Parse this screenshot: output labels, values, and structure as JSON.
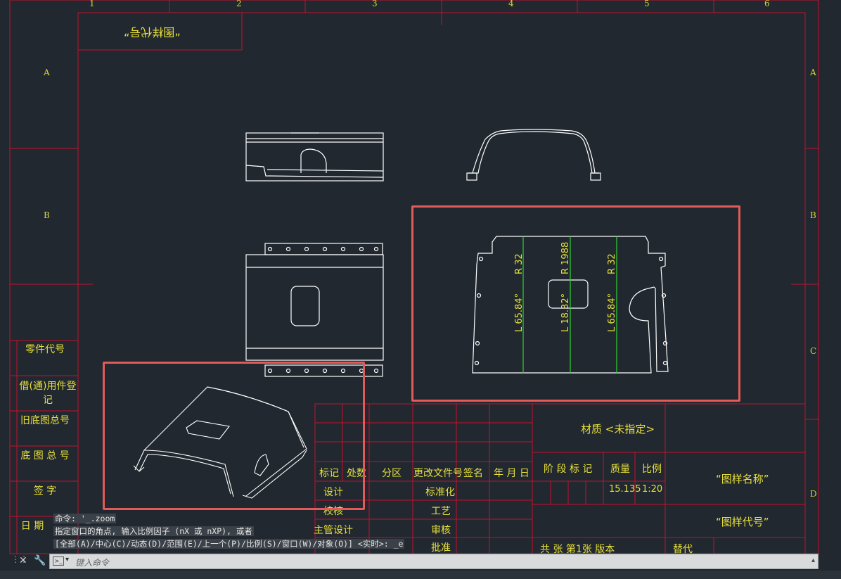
{
  "drawing": {
    "col_numbers": [
      "1",
      "2",
      "3",
      "4",
      "5",
      "6"
    ],
    "row_letters_left": [
      "A",
      "B"
    ],
    "row_letters_right": [
      "A",
      "B",
      "C",
      "D"
    ],
    "drawing_code_box": "“图样代号”",
    "side_labels": [
      "零件代号",
      "借(通)用件登记",
      "旧底图总号",
      "底 图 总 号",
      "签   字",
      "日   期"
    ],
    "dimensions": [
      "R 32",
      "R 1988",
      "R 32",
      "L 65.84°",
      "L 18.32°",
      "L 65.84°"
    ]
  },
  "title_block": {
    "material": "材质 <未指定>",
    "header_cells": [
      "标记",
      "处数",
      "分区",
      "更改文件号",
      "签名",
      "年 月 日"
    ],
    "rows_left": [
      "设计",
      "校核",
      "主管设计"
    ],
    "rows_mid": [
      "标准化",
      "工艺",
      "审核",
      "批准"
    ],
    "stage": "阶 段 标 记",
    "weight_label": "质量",
    "scale_label": "比例",
    "weight_value": "15.135",
    "scale_value": "1:20",
    "drawing_name": "“图样名称”",
    "drawing_code": "“图样代号”",
    "sheet_info": "共  张 第1张 版本",
    "replace": "替代"
  },
  "command_history": [
    "命令: '_.zoom",
    "指定窗口的角点, 输入比例因子 (nX 或 nXP), 或者",
    "[全部(A)/中心(C)/动态(D)/范围(E)/上一个(P)/比例(S)/窗口(W)/对象(O)] <实时>: _e"
  ],
  "command_input": {
    "placeholder": "键入命令"
  },
  "colors": {
    "background": "#212830",
    "frame": "#c8102e",
    "text": "#e8e03a",
    "geometry": "#ffffff",
    "centerline": "#2fd12f",
    "highlight": "#e35a5a"
  }
}
